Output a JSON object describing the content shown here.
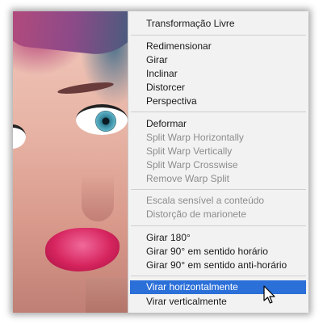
{
  "menu": {
    "items": [
      {
        "label": "Transformação Livre",
        "enabled": true
      },
      {
        "label": "Redimensionar",
        "enabled": true
      },
      {
        "label": "Girar",
        "enabled": true
      },
      {
        "label": "Inclinar",
        "enabled": true
      },
      {
        "label": "Distorcer",
        "enabled": true
      },
      {
        "label": "Perspectiva",
        "enabled": true
      },
      {
        "label": "Deformar",
        "enabled": true
      },
      {
        "label": "Split Warp Horizontally",
        "enabled": false
      },
      {
        "label": "Split Warp Vertically",
        "enabled": false
      },
      {
        "label": "Split Warp Crosswise",
        "enabled": false
      },
      {
        "label": "Remove Warp Split",
        "enabled": false
      },
      {
        "label": "Escala sensível a conteúdo",
        "enabled": false
      },
      {
        "label": "Distorção de marionete",
        "enabled": false
      },
      {
        "label": "Girar 180°",
        "enabled": true
      },
      {
        "label": "Girar 90° em sentido horário",
        "enabled": true
      },
      {
        "label": "Girar 90° em sentido anti-horário",
        "enabled": true
      },
      {
        "label": "Virar horizontalmente",
        "enabled": true,
        "selected": true
      },
      {
        "label": "Virar verticalmente",
        "enabled": true
      }
    ]
  },
  "colors": {
    "selection": "#2b6fd8",
    "disabled_text": "#8c8c8c",
    "menu_background": "#f2f2f2"
  },
  "icons": {
    "pointer": "mouse-pointer-icon"
  }
}
